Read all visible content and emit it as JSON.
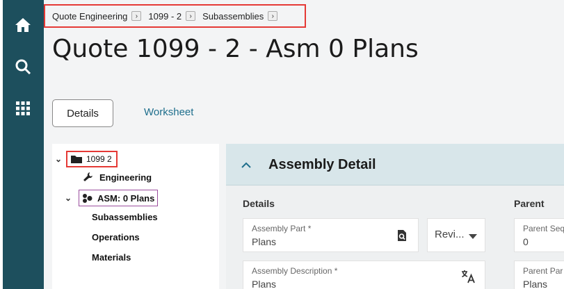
{
  "breadcrumb": [
    {
      "label": "Quote Engineering"
    },
    {
      "label": "1099 - 2"
    },
    {
      "label": "Subassemblies"
    }
  ],
  "page": {
    "title": "Quote 1099 - 2 - Asm 0 Plans"
  },
  "tabs": {
    "details": "Details",
    "worksheet": "Worksheet"
  },
  "tree": {
    "root": "1099 2",
    "engineering": "Engineering",
    "asm": "ASM: 0 Plans",
    "subassemblies": "Subassemblies",
    "operations": "Operations",
    "materials": "Materials"
  },
  "panel": {
    "title": "Assembly Detail",
    "details_label": "Details",
    "parent_label": "Parent",
    "assembly_part": {
      "label": "Assembly Part *",
      "value": "Plans"
    },
    "revision": {
      "value": "Revi..."
    },
    "parent_seq": {
      "label": "Parent Seq",
      "value": "0"
    },
    "assembly_description": {
      "label": "Assembly Description *",
      "value": "Plans"
    },
    "parent_part": {
      "label": "Parent Par",
      "value": "Plans"
    }
  },
  "colors": {
    "sidebar": "#1d4f5d",
    "accent": "#1e6e8c",
    "highlight": "#e53935",
    "purple_box": "#9b4d9e"
  }
}
